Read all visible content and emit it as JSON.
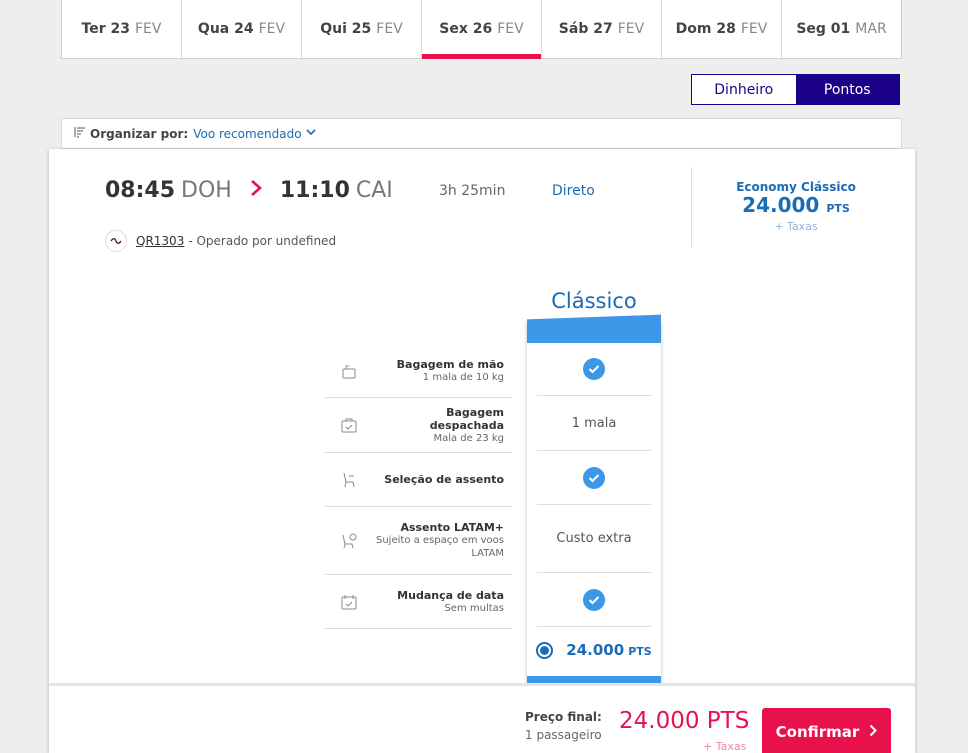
{
  "dates": [
    {
      "day": "Ter 23",
      "month": "FEV",
      "active": false
    },
    {
      "day": "Qua 24",
      "month": "FEV",
      "active": false
    },
    {
      "day": "Qui 25",
      "month": "FEV",
      "active": false
    },
    {
      "day": "Sex 26",
      "month": "FEV",
      "active": true
    },
    {
      "day": "Sáb 27",
      "month": "FEV",
      "active": false
    },
    {
      "day": "Dom 28",
      "month": "FEV",
      "active": false
    },
    {
      "day": "Seg 01",
      "month": "MAR",
      "active": false
    }
  ],
  "toggle": {
    "money": "Dinheiro",
    "points": "Pontos",
    "selected": "points"
  },
  "sort": {
    "label": "Organizar por:",
    "value": "Voo recomendado"
  },
  "flight": {
    "departure_time": "08:45",
    "departure_code": "DOH",
    "arrival_time": "11:10",
    "arrival_code": "CAI",
    "duration": "3h 25min",
    "stops": "Direto",
    "flight_number": "QR1303",
    "operated_by": "- Operado por undefined"
  },
  "fare_summary": {
    "name": "Economy Clássico",
    "price": "24.000",
    "unit": "PTS",
    "taxes": "+ Taxas"
  },
  "benefits": [
    {
      "title": "Bagagem de mão",
      "sub": "1 mala de 10 kg",
      "icon": "carry-on-bag-icon",
      "value": "",
      "check": true
    },
    {
      "title": "Bagagem despachada",
      "sub": "Mala de 23 kg",
      "icon": "checked-bag-icon",
      "value": "1 mala",
      "check": false
    },
    {
      "title": "Seleção de assento",
      "sub": "",
      "icon": "seat-icon",
      "value": "",
      "check": true
    },
    {
      "title": "Assento LATAM+",
      "sub": "Sujeito a espaço em voos LATAM",
      "icon": "seat-plus-icon",
      "value": "Custo extra",
      "check": false
    },
    {
      "title": "Mudança de data",
      "sub": "Sem multas",
      "icon": "calendar-icon",
      "value": "",
      "check": true
    }
  ],
  "fare_column": {
    "title": "Clássico",
    "price": "24.000",
    "unit": "PTS"
  },
  "footer": {
    "final_label": "Preço final:",
    "passengers": "1 passageiro",
    "price": "24.000 PTS",
    "taxes": "+ Taxas",
    "confirm": "Confirmar"
  },
  "colors": {
    "accent": "#e8114b",
    "brand": "#1b0088",
    "fare_blue": "#3d97e8",
    "link_blue": "#1b6bb5"
  }
}
